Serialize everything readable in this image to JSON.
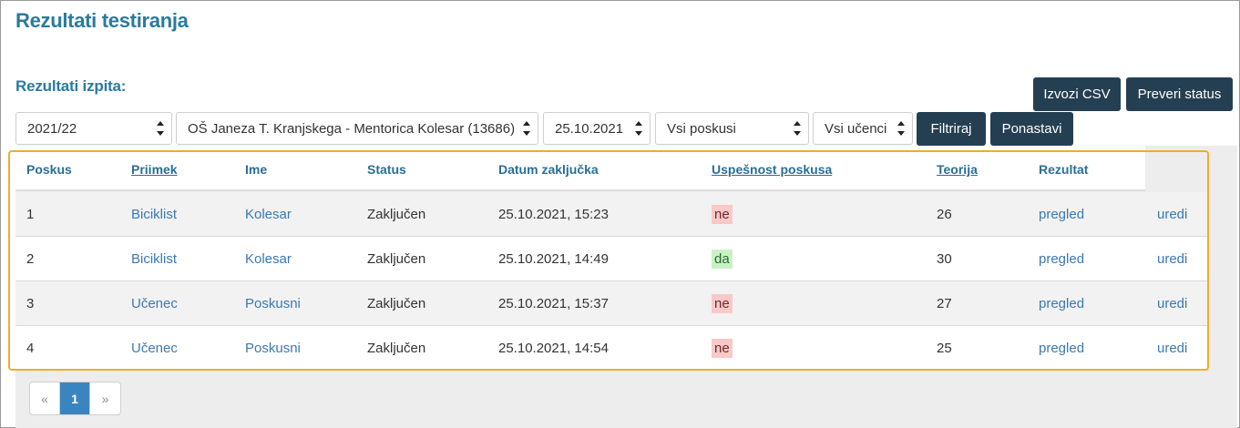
{
  "page": {
    "title": "Rezultati testiranja",
    "section_title": "Rezultati izpita:"
  },
  "toolbar": {
    "export_csv": "Izvozi CSV",
    "check_status": "Preveri status",
    "filter": "Filtriraj",
    "reset": "Ponastavi"
  },
  "filters": {
    "year": "2021/22",
    "school": "OŠ Janeza T. Kranjskega - Mentorica Kolesar (13686)",
    "date": "25.10.2021",
    "attempts": "Vsi poskusi",
    "students": "Vsi učenci"
  },
  "table": {
    "headers": {
      "attempt": "Poskus",
      "surname": "Priimek",
      "name": "Ime",
      "status": "Status",
      "completed": "Datum zaključka",
      "success": "Uspešnost poskusa",
      "theory": "Teorija",
      "result": "Rezultat"
    },
    "rows": [
      {
        "attempt": "1",
        "surname": "Biciklist",
        "name": "Kolesar",
        "status": "Zaključen",
        "completed": "25.10.2021, 15:23",
        "success": "ne",
        "theory": "26",
        "result": "pregled",
        "edit": "uredi"
      },
      {
        "attempt": "2",
        "surname": "Biciklist",
        "name": "Kolesar",
        "status": "Zaključen",
        "completed": "25.10.2021, 14:49",
        "success": "da",
        "theory": "30",
        "result": "pregled",
        "edit": "uredi"
      },
      {
        "attempt": "3",
        "surname": "Učenec",
        "name": "Poskusni",
        "status": "Zaključen",
        "completed": "25.10.2021, 15:37",
        "success": "ne",
        "theory": "27",
        "result": "pregled",
        "edit": "uredi"
      },
      {
        "attempt": "4",
        "surname": "Učenec",
        "name": "Poskusni",
        "status": "Zaključen",
        "completed": "25.10.2021, 14:54",
        "success": "ne",
        "theory": "25",
        "result": "pregled",
        "edit": "uredi"
      }
    ]
  },
  "pagination": {
    "prev": "«",
    "current": "1",
    "next": "»"
  },
  "colors": {
    "accent": "#2a7aa0",
    "button_dark": "#253f52",
    "highlight": "#f0ad2a",
    "fail_bg": "#f9c9c7",
    "pass_bg": "#c9f2c4",
    "page_active": "#3a85c0"
  }
}
